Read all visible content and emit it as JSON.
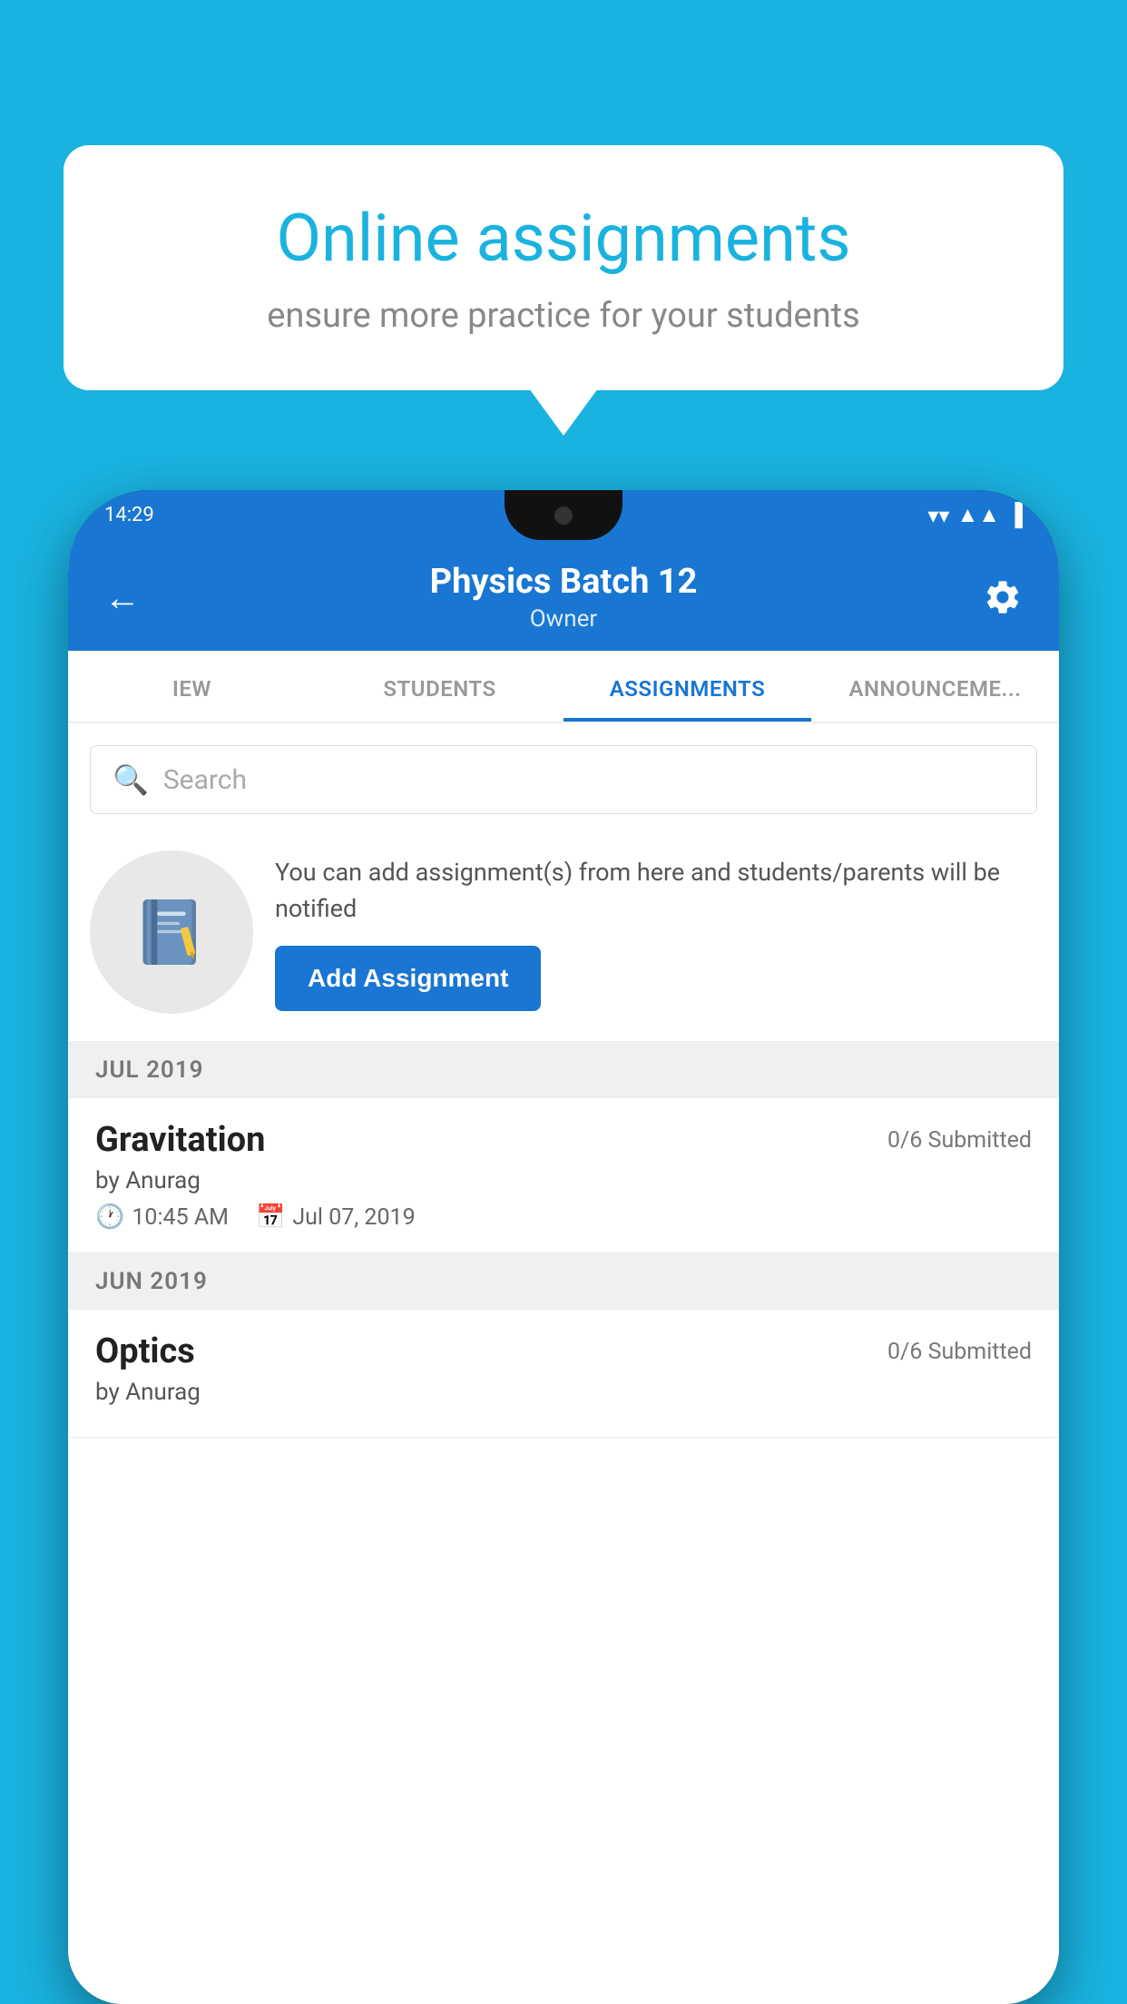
{
  "background": {
    "color": "#1ab3e0"
  },
  "speechBubble": {
    "title": "Online assignments",
    "subtitle": "ensure more practice for your students"
  },
  "statusBar": {
    "time": "14:29",
    "icons": [
      "wifi",
      "signal",
      "battery"
    ]
  },
  "appHeader": {
    "title": "Physics Batch 12",
    "subtitle": "Owner",
    "backLabel": "←",
    "settingsLabel": "⚙"
  },
  "tabs": [
    {
      "label": "IEW",
      "active": false
    },
    {
      "label": "STUDENTS",
      "active": false
    },
    {
      "label": "ASSIGNMENTS",
      "active": true
    },
    {
      "label": "ANNOUNCEME...",
      "active": false
    }
  ],
  "search": {
    "placeholder": "Search"
  },
  "promo": {
    "description": "You can add assignment(s) from here and students/parents will be notified",
    "buttonLabel": "Add Assignment"
  },
  "sections": [
    {
      "label": "JUL 2019",
      "assignments": [
        {
          "title": "Gravitation",
          "submitted": "0/6 Submitted",
          "by": "by Anurag",
          "time": "10:45 AM",
          "date": "Jul 07, 2019"
        }
      ]
    },
    {
      "label": "JUN 2019",
      "assignments": [
        {
          "title": "Optics",
          "submitted": "0/6 Submitted",
          "by": "by Anurag",
          "time": "",
          "date": ""
        }
      ]
    }
  ]
}
